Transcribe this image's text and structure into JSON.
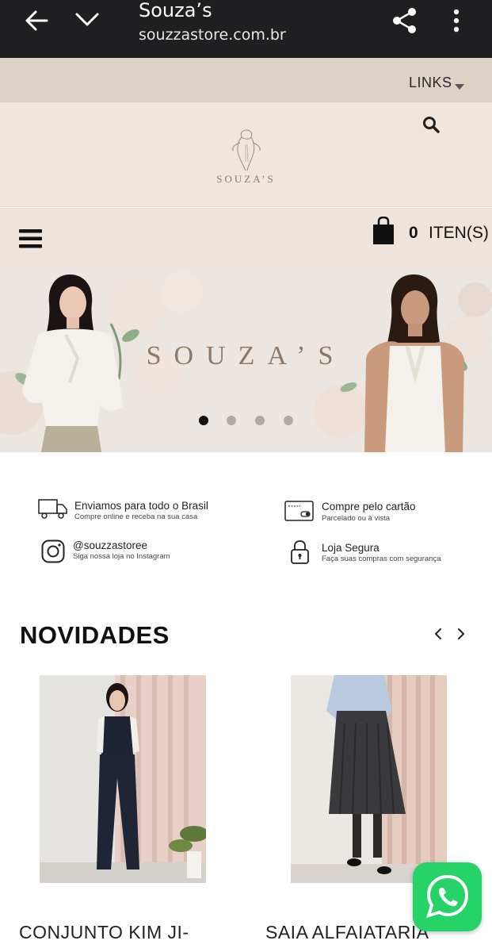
{
  "browser": {
    "title": "Souza’s",
    "url": "souzzastore.com.br"
  },
  "topnav": {
    "links_label": "LINKS"
  },
  "brand": {
    "logo_text": "SOUZA’S"
  },
  "cart": {
    "count": "0",
    "label": "ITEN(S)"
  },
  "banner": {
    "title": "SOUZA’S",
    "slides": 4,
    "active_slide": 1
  },
  "features": [
    {
      "title": "Enviamos para todo o Brasil",
      "subtitle": "Compre online e receba na sua casa",
      "icon": "truck-icon"
    },
    {
      "title": "Compre pelo cartão",
      "subtitle": "Parcelado ou à vista",
      "icon": "credit-card-icon"
    },
    {
      "title": "@souzzastoree",
      "subtitle": "Siga nossa loja no Instagram",
      "icon": "instagram-icon"
    },
    {
      "title": "Loja Segura",
      "subtitle": "Faça suas compras com segurança",
      "icon": "lock-icon"
    }
  ],
  "section": {
    "title": "NOVIDADES"
  },
  "products": [
    {
      "name": "CONJUNTO KIM JI-"
    },
    {
      "name": "SAIA ALFAIATARIA"
    }
  ],
  "colors": {
    "browser_bar": "#1f1f21",
    "links_bar": "#ddd2c6",
    "header_bg": "#f1e6dd",
    "whatsapp": "#25d366"
  }
}
